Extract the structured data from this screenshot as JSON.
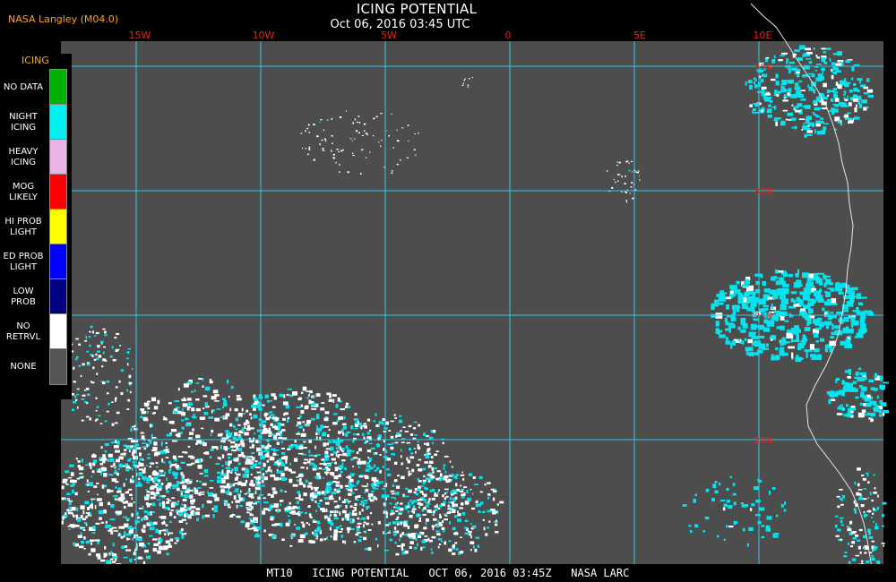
{
  "header": {
    "title": "ICING POTENTIAL",
    "subtitle": "Oct 06, 2016 03:45 UTC",
    "source": "NASA Langley (M04.0)"
  },
  "map": {
    "longitude_labels": [
      "15W",
      "10W",
      "5W",
      "0",
      "5E",
      "10E"
    ],
    "latitude_labels": [
      "35N",
      "30N",
      "25N",
      "20N"
    ],
    "colors": {
      "background": "#4d4d4d",
      "grid": "#31c8e6",
      "coast": "#e6e6e6",
      "cloud_white": "#ffffff",
      "cloud_cyan": "#00e5f0"
    }
  },
  "legend": {
    "header": "ICING",
    "items": [
      {
        "label": "NO DATA",
        "color": "#00b000"
      },
      {
        "label": "NIGHT\nICING",
        "color": "#00f0f0"
      },
      {
        "label": "HEAVY\nICING",
        "color": "#e8b4e6"
      },
      {
        "label": "MOG\nLIKELY",
        "color": "#ff0000"
      },
      {
        "label": "HI PROB\nLIGHT",
        "color": "#ffff00"
      },
      {
        "label": "ED PROB\nLIGHT",
        "color": "#0000ff"
      },
      {
        "label": "LOW\nPROB",
        "color": "#000080"
      },
      {
        "label": "NO\nRETRVL",
        "color": "#ffffff"
      },
      {
        "label": "NONE",
        "color": "#555555"
      }
    ]
  },
  "footer": {
    "product": "MT10",
    "name": "ICING POTENTIAL",
    "datetime": "OCT 06, 2016 03:45Z",
    "agency": "NASA LARC"
  }
}
